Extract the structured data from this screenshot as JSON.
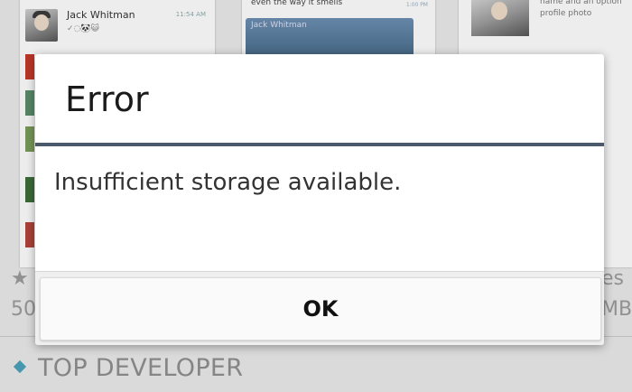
{
  "background": {
    "chat": {
      "contact_name": "Jack Whitman",
      "time": "11:54 AM",
      "status_text": "✓◌🐼😺"
    },
    "message": {
      "text": "even the way it smells",
      "time": "1:00 PM",
      "image_caption": "Jack Whitman"
    },
    "profile": {
      "text_line1": "name and an option",
      "text_line2": "profile photo"
    },
    "partial_left_1": "★",
    "partial_left_2": "50",
    "partial_right_1": "es",
    "partial_right_2": "MB",
    "section_label": "TOP DEVELOPER",
    "accent": "#4aa0b8"
  },
  "dialog": {
    "title": "Error",
    "message": "Insufficient storage available.",
    "ok_label": "OK",
    "divider_color": "#4a5a6a"
  }
}
